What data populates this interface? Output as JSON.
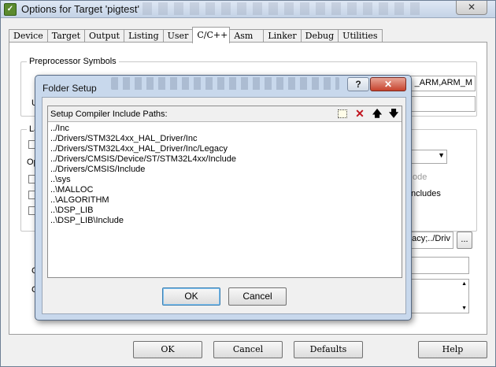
{
  "window": {
    "title": "Options for Target 'pigtest'",
    "close_label": "✕"
  },
  "tabs": [
    {
      "label": "Device"
    },
    {
      "label": "Target"
    },
    {
      "label": "Output"
    },
    {
      "label": "Listing"
    },
    {
      "label": "User"
    },
    {
      "label": "C/C++",
      "active": true
    },
    {
      "label": "Asm"
    },
    {
      "label": "Linker"
    },
    {
      "label": "Debug"
    },
    {
      "label": "Utilities"
    }
  ],
  "background": {
    "preprocessor_label": "Preprocessor Symbols",
    "define_value_visible": "_ARM,ARM_M",
    "row_label_u": "U",
    "group2_label": "La",
    "opt_label": "Op",
    "faded_text": "ode",
    "includes_text": "ncludes",
    "include_paths_visible": "acy;../Driv",
    "browse_label": "...",
    "label_c": "C",
    "label_c2": "C"
  },
  "bottom_buttons": {
    "ok": "OK",
    "cancel": "Cancel",
    "defaults": "Defaults",
    "help": "Help"
  },
  "dialog": {
    "title": "Folder Setup",
    "help_label": "?",
    "close_label": "✕",
    "header_label": "Setup Compiler Include Paths:",
    "toolbar": {
      "delete_glyph": "✕",
      "up_glyph": "🡅",
      "down_glyph": "🡇"
    },
    "paths": [
      "../Inc",
      "../Drivers/STM32L4xx_HAL_Driver/Inc",
      "../Drivers/STM32L4xx_HAL_Driver/Inc/Legacy",
      "../Drivers/CMSIS/Device/ST/STM32L4xx/Include",
      "../Drivers/CMSIS/Include",
      "..\\sys",
      "..\\MALLOC",
      "..\\ALGORITHM",
      "..\\DSP_LIB",
      "..\\DSP_LIB\\Include"
    ],
    "ok_label": "OK",
    "cancel_label": "Cancel"
  },
  "colors": {
    "dialog_frame": "#c8d8ec",
    "close_red": "#c7432d",
    "delete_red": "#c0141e"
  }
}
